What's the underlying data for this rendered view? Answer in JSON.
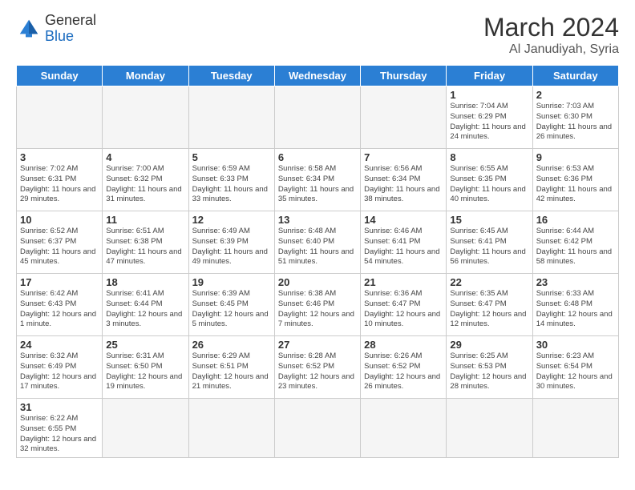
{
  "header": {
    "logo_general": "General",
    "logo_blue": "Blue",
    "month_year": "March 2024",
    "location": "Al Janudiyah, Syria"
  },
  "weekdays": [
    "Sunday",
    "Monday",
    "Tuesday",
    "Wednesday",
    "Thursday",
    "Friday",
    "Saturday"
  ],
  "weeks": [
    [
      {
        "day": "",
        "info": ""
      },
      {
        "day": "",
        "info": ""
      },
      {
        "day": "",
        "info": ""
      },
      {
        "day": "",
        "info": ""
      },
      {
        "day": "",
        "info": ""
      },
      {
        "day": "1",
        "info": "Sunrise: 7:04 AM\nSunset: 6:29 PM\nDaylight: 11 hours\nand 24 minutes."
      },
      {
        "day": "2",
        "info": "Sunrise: 7:03 AM\nSunset: 6:30 PM\nDaylight: 11 hours\nand 26 minutes."
      }
    ],
    [
      {
        "day": "3",
        "info": "Sunrise: 7:02 AM\nSunset: 6:31 PM\nDaylight: 11 hours\nand 29 minutes."
      },
      {
        "day": "4",
        "info": "Sunrise: 7:00 AM\nSunset: 6:32 PM\nDaylight: 11 hours\nand 31 minutes."
      },
      {
        "day": "5",
        "info": "Sunrise: 6:59 AM\nSunset: 6:33 PM\nDaylight: 11 hours\nand 33 minutes."
      },
      {
        "day": "6",
        "info": "Sunrise: 6:58 AM\nSunset: 6:34 PM\nDaylight: 11 hours\nand 35 minutes."
      },
      {
        "day": "7",
        "info": "Sunrise: 6:56 AM\nSunset: 6:34 PM\nDaylight: 11 hours\nand 38 minutes."
      },
      {
        "day": "8",
        "info": "Sunrise: 6:55 AM\nSunset: 6:35 PM\nDaylight: 11 hours\nand 40 minutes."
      },
      {
        "day": "9",
        "info": "Sunrise: 6:53 AM\nSunset: 6:36 PM\nDaylight: 11 hours\nand 42 minutes."
      }
    ],
    [
      {
        "day": "10",
        "info": "Sunrise: 6:52 AM\nSunset: 6:37 PM\nDaylight: 11 hours\nand 45 minutes."
      },
      {
        "day": "11",
        "info": "Sunrise: 6:51 AM\nSunset: 6:38 PM\nDaylight: 11 hours\nand 47 minutes."
      },
      {
        "day": "12",
        "info": "Sunrise: 6:49 AM\nSunset: 6:39 PM\nDaylight: 11 hours\nand 49 minutes."
      },
      {
        "day": "13",
        "info": "Sunrise: 6:48 AM\nSunset: 6:40 PM\nDaylight: 11 hours\nand 51 minutes."
      },
      {
        "day": "14",
        "info": "Sunrise: 6:46 AM\nSunset: 6:41 PM\nDaylight: 11 hours\nand 54 minutes."
      },
      {
        "day": "15",
        "info": "Sunrise: 6:45 AM\nSunset: 6:41 PM\nDaylight: 11 hours\nand 56 minutes."
      },
      {
        "day": "16",
        "info": "Sunrise: 6:44 AM\nSunset: 6:42 PM\nDaylight: 11 hours\nand 58 minutes."
      }
    ],
    [
      {
        "day": "17",
        "info": "Sunrise: 6:42 AM\nSunset: 6:43 PM\nDaylight: 12 hours\nand 1 minute."
      },
      {
        "day": "18",
        "info": "Sunrise: 6:41 AM\nSunset: 6:44 PM\nDaylight: 12 hours\nand 3 minutes."
      },
      {
        "day": "19",
        "info": "Sunrise: 6:39 AM\nSunset: 6:45 PM\nDaylight: 12 hours\nand 5 minutes."
      },
      {
        "day": "20",
        "info": "Sunrise: 6:38 AM\nSunset: 6:46 PM\nDaylight: 12 hours\nand 7 minutes."
      },
      {
        "day": "21",
        "info": "Sunrise: 6:36 AM\nSunset: 6:47 PM\nDaylight: 12 hours\nand 10 minutes."
      },
      {
        "day": "22",
        "info": "Sunrise: 6:35 AM\nSunset: 6:47 PM\nDaylight: 12 hours\nand 12 minutes."
      },
      {
        "day": "23",
        "info": "Sunrise: 6:33 AM\nSunset: 6:48 PM\nDaylight: 12 hours\nand 14 minutes."
      }
    ],
    [
      {
        "day": "24",
        "info": "Sunrise: 6:32 AM\nSunset: 6:49 PM\nDaylight: 12 hours\nand 17 minutes."
      },
      {
        "day": "25",
        "info": "Sunrise: 6:31 AM\nSunset: 6:50 PM\nDaylight: 12 hours\nand 19 minutes."
      },
      {
        "day": "26",
        "info": "Sunrise: 6:29 AM\nSunset: 6:51 PM\nDaylight: 12 hours\nand 21 minutes."
      },
      {
        "day": "27",
        "info": "Sunrise: 6:28 AM\nSunset: 6:52 PM\nDaylight: 12 hours\nand 23 minutes."
      },
      {
        "day": "28",
        "info": "Sunrise: 6:26 AM\nSunset: 6:52 PM\nDaylight: 12 hours\nand 26 minutes."
      },
      {
        "day": "29",
        "info": "Sunrise: 6:25 AM\nSunset: 6:53 PM\nDaylight: 12 hours\nand 28 minutes."
      },
      {
        "day": "30",
        "info": "Sunrise: 6:23 AM\nSunset: 6:54 PM\nDaylight: 12 hours\nand 30 minutes."
      }
    ],
    [
      {
        "day": "31",
        "info": "Sunrise: 6:22 AM\nSunset: 6:55 PM\nDaylight: 12 hours\nand 32 minutes."
      },
      {
        "day": "",
        "info": ""
      },
      {
        "day": "",
        "info": ""
      },
      {
        "day": "",
        "info": ""
      },
      {
        "day": "",
        "info": ""
      },
      {
        "day": "",
        "info": ""
      },
      {
        "day": "",
        "info": ""
      }
    ]
  ]
}
